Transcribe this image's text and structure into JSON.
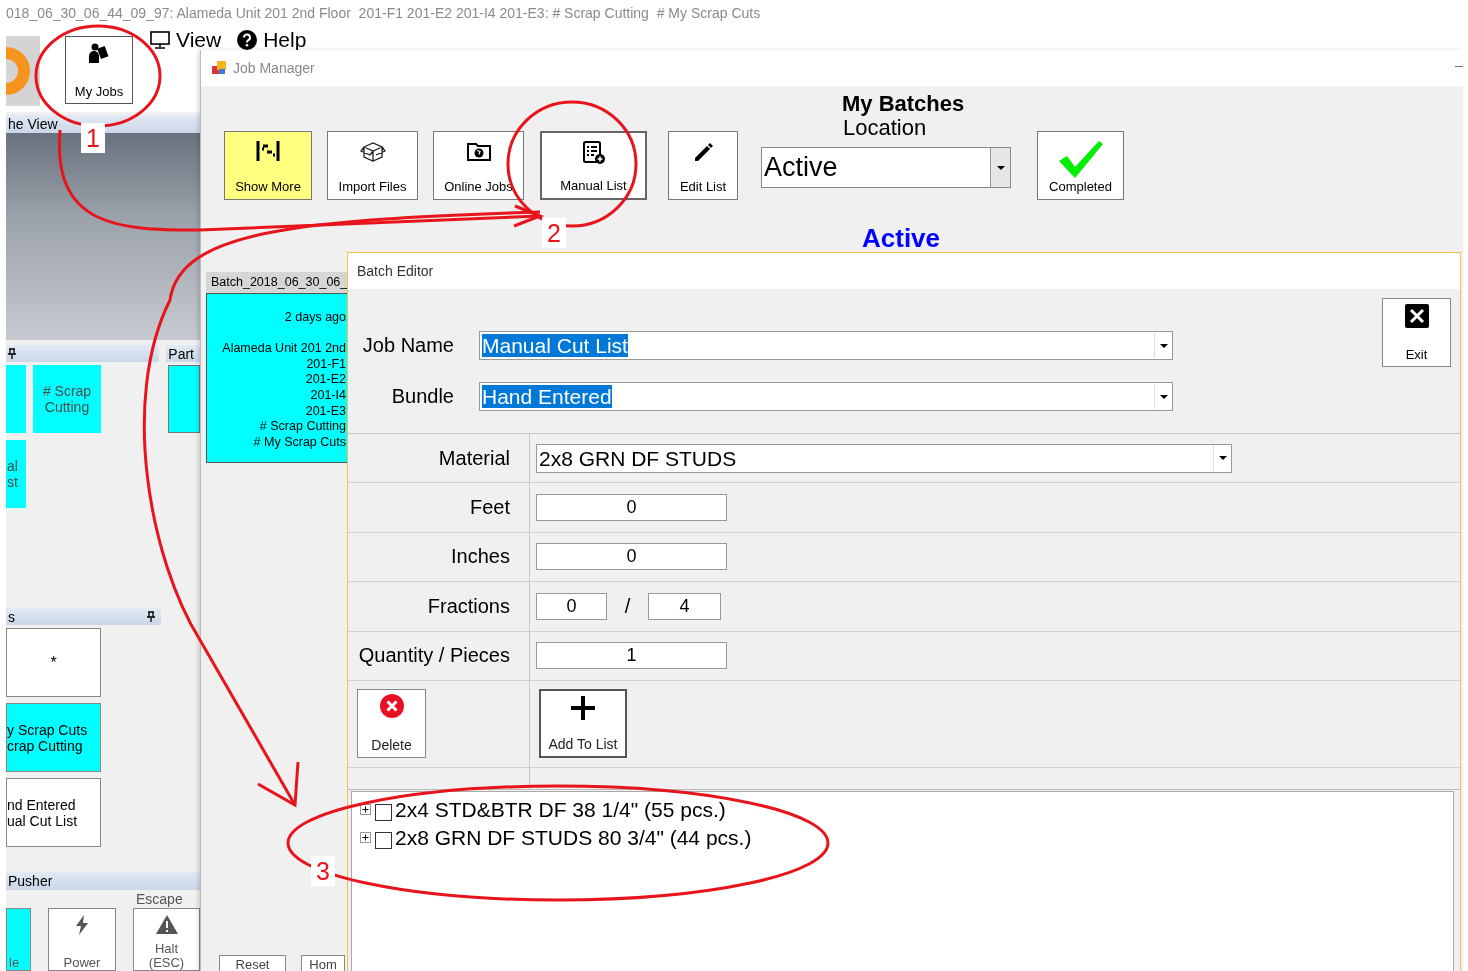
{
  "title_bar": {
    "text": "018_06_30_06_44_09_97: Alameda Unit 201 2nd Floor  201-F1 201-E2 201-I4 201-E3: # Scrap Cutting  # My Scrap Cuts"
  },
  "main_toolbar": {
    "my_jobs": "My Jobs",
    "menus": [
      "View",
      "Help"
    ]
  },
  "left_panels": {
    "view_header": "he View",
    "part_header": "Part",
    "tiles": [
      {
        "color": "#00ffff"
      },
      {
        "text": "# Scrap\nCutting",
        "color": "#00ffff"
      },
      {
        "text": "al\nst",
        "color": "#00ffff"
      }
    ],
    "part_tiles": [
      {
        "color": "#00ffff"
      }
    ],
    "list_header": "s",
    "list_tiles": [
      {
        "text": "*",
        "color": "#ffffff"
      },
      {
        "text": "y Scrap Cuts\ncrap Cutting",
        "color": "#00ffff"
      },
      {
        "text": "nd Entered\nual Cut List",
        "color": "#ffffff"
      }
    ],
    "pusher_header": "Pusher",
    "escape_label": "Escape",
    "bottom_buttons": [
      {
        "label": "le",
        "kind": "partial"
      },
      {
        "label": "Power",
        "kind": "power"
      },
      {
        "label": "Halt\n(ESC)",
        "kind": "halt"
      }
    ]
  },
  "job_manager": {
    "title": "Job Manager",
    "toolbar": [
      {
        "label": "Show More",
        "kind": "show-more",
        "highlighted": true
      },
      {
        "label": "Import Files",
        "kind": "import",
        "highlighted": false
      },
      {
        "label": "Online Jobs",
        "kind": "online",
        "highlighted": false
      },
      {
        "label": "Manual List",
        "kind": "manual",
        "highlighted": false
      },
      {
        "label": "Edit List",
        "kind": "edit",
        "highlighted": false
      }
    ],
    "heading": "My Batches",
    "location_label": "Location",
    "location_value": "Active",
    "completed": "Completed",
    "status_heading": "Active",
    "batch": {
      "header": "Batch_2018_06_30_06_",
      "text": "2 days ago\n\nAlameda Unit 201 2nd\n201-F1\n201-E2\n201-I4\n201-E3\n# Scrap Cutting\n# My Scrap Cuts"
    },
    "bottom_buttons": [
      "Reset",
      "Hom"
    ]
  },
  "batch_editor": {
    "title": "Batch Editor",
    "exit": "Exit",
    "fields": [
      {
        "label": "Job Name",
        "value": "Manual Cut List",
        "selected": true
      },
      {
        "label": "Bundle",
        "value": "Hand Entered",
        "selected": true
      }
    ],
    "rows": [
      {
        "kind": "dropdown",
        "label": "Material",
        "value": "2x8 GRN DF STUDS"
      },
      {
        "kind": "number",
        "label": "Feet",
        "value": "0"
      },
      {
        "kind": "number",
        "label": "Inches",
        "value": "0"
      },
      {
        "kind": "fraction",
        "label": "Fractions",
        "numerator": "0",
        "separator": "/",
        "denominator": "4"
      },
      {
        "kind": "number",
        "label": "Quantity / Pieces",
        "value": "1"
      }
    ],
    "delete": "Delete",
    "add": "Add To List",
    "tree": [
      {
        "label": "2x4 STD&BTR DF 38 1/4\" (55 pcs.)",
        "checked": false,
        "expanded": false
      },
      {
        "label": "2x8 GRN DF STUDS 80 3/4\" (44 pcs.)",
        "checked": false,
        "expanded": false
      }
    ]
  },
  "annotations": [
    {
      "number": "1"
    },
    {
      "number": "2"
    },
    {
      "number": "3"
    }
  ]
}
